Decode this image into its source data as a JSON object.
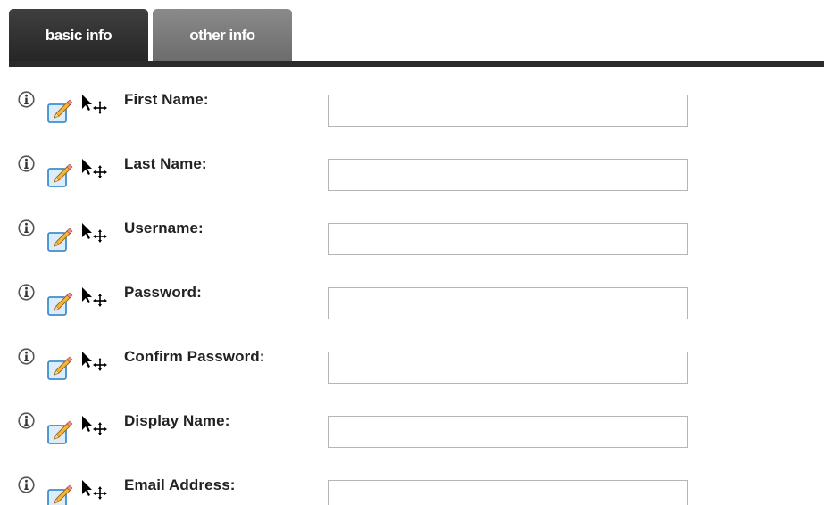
{
  "tabs": [
    {
      "label": "basic info",
      "active": true
    },
    {
      "label": "other info",
      "active": false
    }
  ],
  "colors": {
    "active_tab": "#2f2f2f",
    "inactive_tab": "#777777",
    "tab_underline": "#2b2b2b",
    "field_border": "#b5b5b5",
    "label_text": "#222222"
  },
  "icons": {
    "info": "info-icon",
    "edit": "pencil-edit-icon",
    "move": "move-cursor-icon"
  },
  "fields": [
    {
      "label": "First Name:",
      "value": ""
    },
    {
      "label": "Last Name:",
      "value": ""
    },
    {
      "label": "Username:",
      "value": ""
    },
    {
      "label": "Password:",
      "value": ""
    },
    {
      "label": "Confirm Password:",
      "value": ""
    },
    {
      "label": "Display Name:",
      "value": ""
    },
    {
      "label": "Email Address:",
      "value": ""
    }
  ]
}
